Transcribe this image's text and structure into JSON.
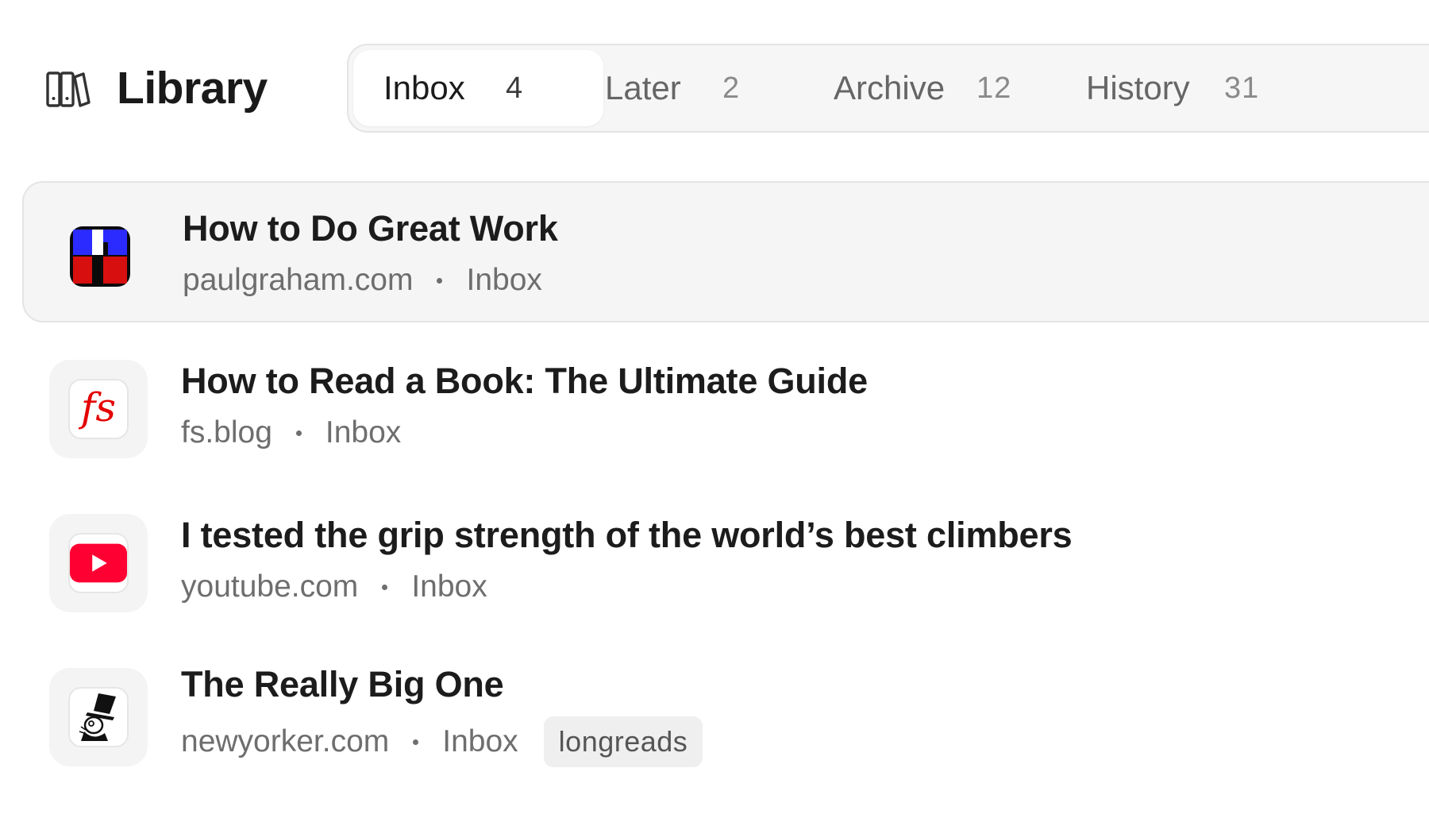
{
  "header": {
    "icon": "books-icon",
    "title": "Library"
  },
  "tabs": [
    {
      "label": "Inbox",
      "count": "4",
      "active": true
    },
    {
      "label": "Later",
      "count": "2",
      "active": false
    },
    {
      "label": "Archive",
      "count": "12",
      "active": false
    },
    {
      "label": "History",
      "count": "31",
      "active": false
    }
  ],
  "items": [
    {
      "title": "How to Do Great Work",
      "domain": "paulgraham.com",
      "location": "Inbox",
      "icon": "paulgraham-favicon",
      "selected": true
    },
    {
      "title": "How to Read a Book: The Ultimate Guide",
      "domain": "fs.blog",
      "location": "Inbox",
      "icon": "fs-blog-favicon",
      "favicon_text": "fs",
      "selected": false
    },
    {
      "title": "I tested the grip strength of the world’s best climbers",
      "domain": "youtube.com",
      "location": "Inbox",
      "icon": "youtube-play-icon",
      "selected": false
    },
    {
      "title": "The Really Big One",
      "domain": "newyorker.com",
      "location": "Inbox",
      "icon": "newyorker-eustace-icon",
      "tag": "longreads",
      "selected": false
    }
  ],
  "colors": {
    "accent_red": "#e40000",
    "youtube_red": "#ff0033",
    "paulgraham_blue": "#2b2bff",
    "paulgraham_red": "#d80f0f"
  }
}
